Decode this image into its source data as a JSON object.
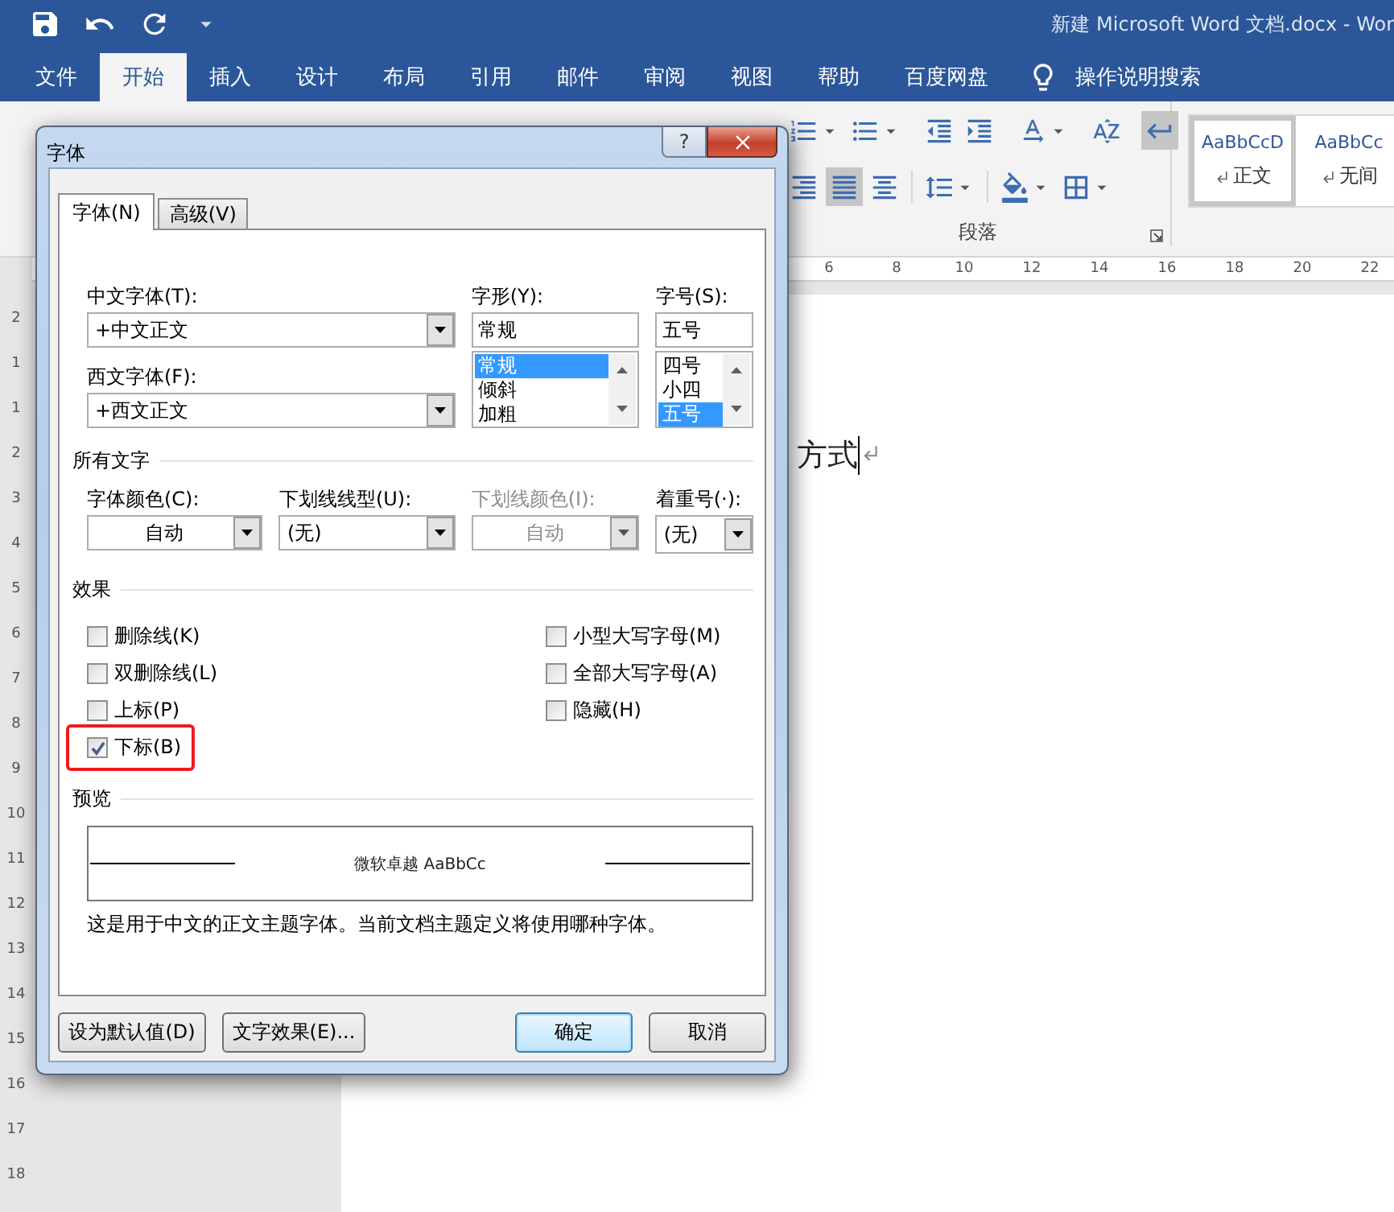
{
  "titlebar": {
    "title": "新建 Microsoft Word 文档.docx  -  Wor"
  },
  "ribbon_tabs": [
    {
      "label": "文件",
      "selected": false
    },
    {
      "label": "开始",
      "selected": true
    },
    {
      "label": "插入",
      "selected": false
    },
    {
      "label": "设计",
      "selected": false
    },
    {
      "label": "布局",
      "selected": false
    },
    {
      "label": "引用",
      "selected": false
    },
    {
      "label": "邮件",
      "selected": false
    },
    {
      "label": "审阅",
      "selected": false
    },
    {
      "label": "视图",
      "selected": false
    },
    {
      "label": "帮助",
      "selected": false
    },
    {
      "label": "百度网盘",
      "selected": false
    }
  ],
  "tell_me": "操作说明搜索",
  "paragraph_group": {
    "label": "段落",
    "rows": [
      [
        {
          "kind": "numbering",
          "dropdown": true,
          "selected": false
        },
        {
          "kind": "multilevel",
          "dropdown": true,
          "selected": false
        },
        {
          "kind": "separator"
        },
        {
          "kind": "indent-decrease",
          "dropdown": false,
          "selected": false
        },
        {
          "kind": "indent-increase",
          "dropdown": false,
          "selected": false
        },
        {
          "kind": "separator"
        },
        {
          "kind": "asian-layout",
          "dropdown": true,
          "selected": false
        },
        {
          "kind": "separator"
        },
        {
          "kind": "sort",
          "dropdown": false,
          "selected": false
        },
        {
          "kind": "separator"
        },
        {
          "kind": "show-marks",
          "dropdown": false,
          "selected": true
        }
      ],
      [
        {
          "kind": "align-right",
          "dropdown": false,
          "selected": false
        },
        {
          "kind": "justify",
          "dropdown": false,
          "selected": true
        },
        {
          "kind": "distributed",
          "dropdown": false,
          "selected": false
        },
        {
          "kind": "separator"
        },
        {
          "kind": "line-spacing",
          "dropdown": true,
          "selected": false
        },
        {
          "kind": "separator"
        },
        {
          "kind": "shading",
          "dropdown": true,
          "selected": false
        },
        {
          "kind": "borders",
          "dropdown": true,
          "selected": false
        }
      ]
    ]
  },
  "styles": [
    {
      "sample": "AaBbCcD",
      "name": "正文",
      "selected": true
    },
    {
      "sample": "AaBbCc",
      "name": "无间",
      "selected": false
    }
  ],
  "hruler": [
    "6",
    "8",
    "10",
    "12",
    "14",
    "16",
    "18",
    "20",
    "22"
  ],
  "vruler": [
    "2",
    "1",
    "1",
    "2",
    "3",
    "4",
    "5",
    "6",
    "7",
    "8",
    "9",
    "10",
    "11",
    "12",
    "13",
    "14",
    "15",
    "16",
    "17",
    "18"
  ],
  "document": {
    "text": "方式"
  },
  "dialog": {
    "title": "字体",
    "help": "?",
    "tabs": [
      {
        "label": "字体(N)",
        "selected": true
      },
      {
        "label": "高级(V)",
        "selected": false
      }
    ],
    "asian_font": {
      "label": "中文字体(T):",
      "value": "+中文正文"
    },
    "latin_font": {
      "label": "西文字体(F):",
      "value": "+西文正文"
    },
    "style": {
      "label": "字形(Y):",
      "value": "常规",
      "options": [
        {
          "label": "常规",
          "selected": true
        },
        {
          "label": "倾斜",
          "selected": false
        },
        {
          "label": "加粗",
          "selected": false
        }
      ]
    },
    "size": {
      "label": "字号(S):",
      "value": "五号",
      "options": [
        {
          "label": "四号",
          "selected": false
        },
        {
          "label": "小四",
          "selected": false
        },
        {
          "label": "五号",
          "selected": true
        }
      ]
    },
    "all_text": {
      "heading": "所有文字",
      "fields": [
        {
          "label": "字体颜色(C):",
          "value": "自动",
          "disabled": false,
          "centered": true
        },
        {
          "label": "下划线线型(U):",
          "value": "(无)",
          "disabled": false,
          "centered": false
        },
        {
          "label": "下划线颜色(I):",
          "value": "自动",
          "disabled": true,
          "centered": true
        },
        {
          "label": "着重号(·):",
          "value": "(无)",
          "disabled": false,
          "centered": false
        }
      ]
    },
    "effects": {
      "heading": "效果",
      "left": [
        {
          "label": "删除线(K)",
          "checked": false,
          "highlighted": false
        },
        {
          "label": "双删除线(L)",
          "checked": false,
          "highlighted": false
        },
        {
          "label": "上标(P)",
          "checked": false,
          "highlighted": false
        },
        {
          "label": "下标(B)",
          "checked": true,
          "highlighted": true
        }
      ],
      "right": [
        {
          "label": "小型大写字母(M)",
          "checked": false,
          "highlighted": false
        },
        {
          "label": "全部大写字母(A)",
          "checked": false,
          "highlighted": false
        },
        {
          "label": "隐藏(H)",
          "checked": false,
          "highlighted": false
        }
      ]
    },
    "preview": {
      "heading": "预览",
      "sample": "微软卓越  AaBbCc",
      "note": "这是用于中文的正文主题字体。当前文档主题定义将使用哪种字体。"
    },
    "buttons": [
      {
        "label": "设为默认值(D)",
        "default": false
      },
      {
        "label": "文字效果(E)...",
        "default": false
      },
      {
        "label": "确定",
        "default": true
      },
      {
        "label": "取消",
        "default": false
      }
    ]
  }
}
